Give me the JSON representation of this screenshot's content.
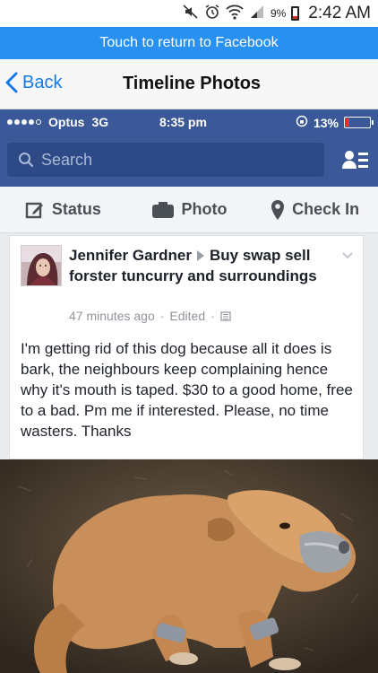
{
  "android_status": {
    "battery_percent": "9%",
    "time": "2:42 AM"
  },
  "return_bar": {
    "label": "Touch to return to Facebook"
  },
  "browser_nav": {
    "back_label": "Back",
    "title": "Timeline Photos"
  },
  "ios_status": {
    "carrier": "Optus",
    "network": "3G",
    "time": "8:35 pm",
    "battery_percent": "13%"
  },
  "facebook": {
    "search_placeholder": "Search",
    "actions": [
      {
        "label": "Status",
        "icon": "status-edit-icon"
      },
      {
        "label": "Photo",
        "icon": "camera-icon"
      },
      {
        "label": "Check In",
        "icon": "location-pin-icon"
      }
    ]
  },
  "post": {
    "author": "Jennifer Gardner",
    "group": "Buy swap sell forster tuncurry and surroundings",
    "timestamp": "47 minutes ago",
    "edited": "Edited",
    "body": "I'm getting rid of this dog because all it does is bark, the neighbours keep complaining hence why it's mouth is taped. $30 to a good home, free to a bad. Pm me if interested. Please, no time wasters. Thanks"
  },
  "colors": {
    "facebook_blue": "#3b5998",
    "return_bar_blue": "#2790f0",
    "ios_link_blue": "#1679e6"
  }
}
